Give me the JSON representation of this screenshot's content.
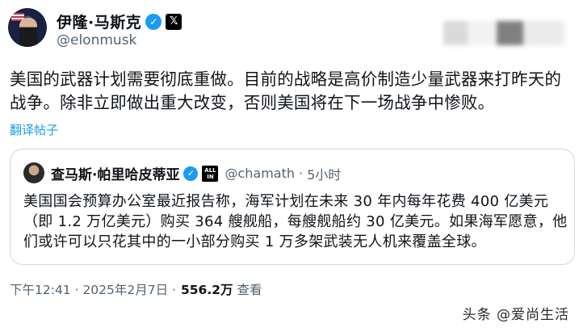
{
  "author": {
    "display_name": "伊隆·马斯克",
    "handle": "@elonmusk",
    "verified_icon": "✓",
    "x_icon": "𝕏"
  },
  "tweet": {
    "text": "美国的武器计划需要彻底重做。目前的战略是高价制造少量武器来打昨天的战争。除非立即做出重大改变，否则美国将在下一场战争中惨败。",
    "translate_label": "翻译帖子"
  },
  "quoted": {
    "display_name": "查马斯·帕里哈皮蒂亚",
    "verified_icon": "✓",
    "badge_text": "ALL IN",
    "handle": "@chamath",
    "separator": "·",
    "time": "5小时",
    "text": "美国国会预算办公室最近报告称，海军计划在未来 30 年内每年花费 400 亿美元（即 1.2 万亿美元）购买 364 艘舰船，每艘舰船约 30 亿美元。如果海军愿意，他们或许可以只花其中的一小部分购买 1 万多架武装无人机来覆盖全球。"
  },
  "meta": {
    "timestamp": "下午12:41 · 2025年2月7日 ·",
    "views": "556.2万",
    "views_label": "查看"
  },
  "watermark": "头条 @爱尚生活",
  "colors": {
    "accent": "#1d9bf0",
    "secondary_text": "#536471",
    "primary_text": "#0f1419",
    "border": "#cfd9de"
  }
}
